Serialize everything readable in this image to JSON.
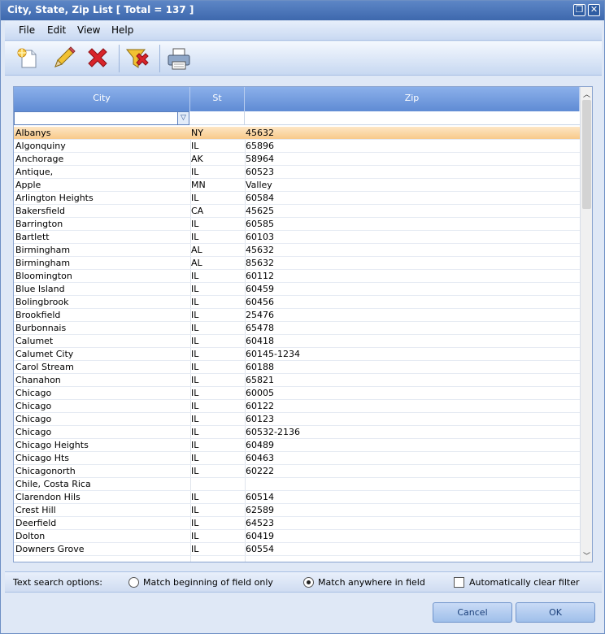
{
  "window": {
    "title": "City, State, Zip List [ Total = 137 ]",
    "restore_glyph": "❐",
    "close_glyph": "✕"
  },
  "menu": [
    "File",
    "Edit",
    "View",
    "Help"
  ],
  "toolbar": {
    "icons": [
      "new-icon",
      "edit-pencil-icon",
      "delete-x-icon",
      "clear-filter-icon",
      "print-icon"
    ]
  },
  "grid": {
    "columns": {
      "city": "City",
      "st": "St",
      "zip": "Zip"
    },
    "filter_value": "",
    "rows": [
      {
        "city": "Albanys",
        "st": "NY",
        "zip": "45632"
      },
      {
        "city": "Algonquiny",
        "st": "IL",
        "zip": "65896"
      },
      {
        "city": "Anchorage",
        "st": "AK",
        "zip": "58964"
      },
      {
        "city": "Antique,",
        "st": "IL",
        "zip": "60523"
      },
      {
        "city": "Apple",
        "st": "MN",
        "zip": "Valley"
      },
      {
        "city": "Arlington Heights",
        "st": "IL",
        "zip": "60584"
      },
      {
        "city": "Bakersfield",
        "st": "CA",
        "zip": "45625"
      },
      {
        "city": "Barrington",
        "st": "IL",
        "zip": "60585"
      },
      {
        "city": "Bartlett",
        "st": "IL",
        "zip": "60103"
      },
      {
        "city": "Birmingham",
        "st": "AL",
        "zip": "45632"
      },
      {
        "city": "Birmingham",
        "st": "AL",
        "zip": "85632"
      },
      {
        "city": "Bloomington",
        "st": "IL",
        "zip": "60112"
      },
      {
        "city": "Blue Island",
        "st": "IL",
        "zip": "60459"
      },
      {
        "city": "Bolingbrook",
        "st": "IL",
        "zip": "60456"
      },
      {
        "city": "Brookfield",
        "st": "IL",
        "zip": "25476"
      },
      {
        "city": "Burbonnais",
        "st": "IL",
        "zip": "65478"
      },
      {
        "city": "Calumet",
        "st": "IL",
        "zip": "60418"
      },
      {
        "city": "Calumet City",
        "st": "IL",
        "zip": "60145-1234"
      },
      {
        "city": "Carol Stream",
        "st": "IL",
        "zip": "60188"
      },
      {
        "city": "Chanahon",
        "st": "IL",
        "zip": "65821"
      },
      {
        "city": "Chicago",
        "st": "IL",
        "zip": "60005"
      },
      {
        "city": "Chicago",
        "st": "IL",
        "zip": "60122"
      },
      {
        "city": "Chicago",
        "st": "IL",
        "zip": "60123"
      },
      {
        "city": "Chicago",
        "st": "IL",
        "zip": "60532-2136"
      },
      {
        "city": "Chicago Heights",
        "st": "IL",
        "zip": "60489"
      },
      {
        "city": "Chicago Hts",
        "st": "IL",
        "zip": "60463"
      },
      {
        "city": "Chicagonorth",
        "st": "IL",
        "zip": "60222"
      },
      {
        "city": "Chile, Costa Rica",
        "st": "",
        "zip": ""
      },
      {
        "city": "Clarendon Hils",
        "st": "IL",
        "zip": "60514"
      },
      {
        "city": "Crest Hill",
        "st": "IL",
        "zip": "62589"
      },
      {
        "city": "Deerfield",
        "st": "IL",
        "zip": "64523"
      },
      {
        "city": "Dolton",
        "st": "IL",
        "zip": "60419"
      },
      {
        "city": "Downers Grove",
        "st": "IL",
        "zip": "60554"
      }
    ],
    "selected_index": 0
  },
  "search_options": {
    "label": "Text search options:",
    "match_beginning": "Match beginning of field only",
    "match_anywhere": "Match anywhere in field",
    "auto_clear": "Automatically clear filter",
    "selected": "match_anywhere"
  },
  "buttons": {
    "cancel": "Cancel",
    "ok": "OK"
  }
}
